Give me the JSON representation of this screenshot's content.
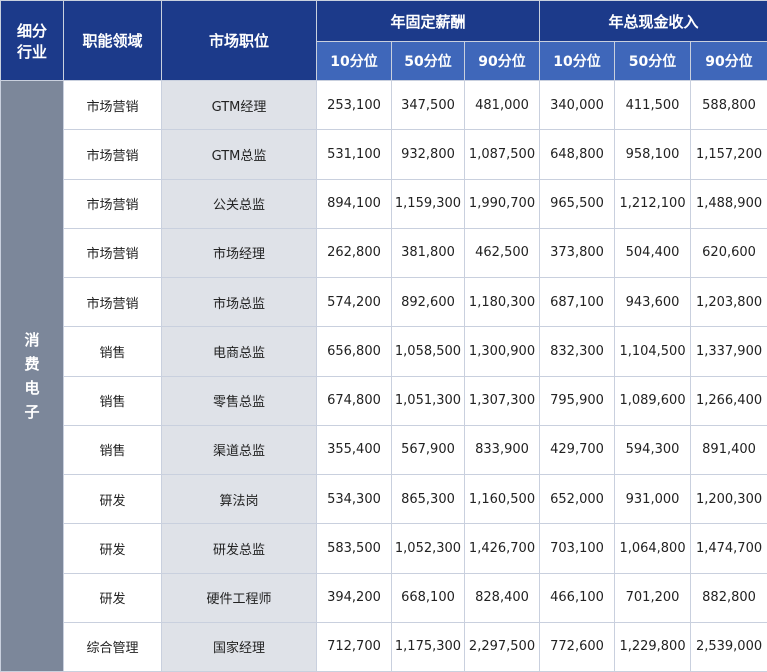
{
  "headers": {
    "industry": [
      "细分",
      "行业"
    ],
    "function": "职能领域",
    "position": "市场职位",
    "fixed_salary": "年固定薪酬",
    "total_cash": "年总现金收入",
    "percentiles": [
      "10分位",
      "50分位",
      "90分位"
    ]
  },
  "industry": [
    "消",
    "费",
    "电",
    "子"
  ],
  "rows": [
    {
      "function": "市场营销",
      "position": "GTM经理",
      "fixed": [
        "253,100",
        "347,500",
        "481,000"
      ],
      "total": [
        "340,000",
        "411,500",
        "588,800"
      ]
    },
    {
      "function": "市场营销",
      "position": "GTM总监",
      "fixed": [
        "531,100",
        "932,800",
        "1,087,500"
      ],
      "total": [
        "648,800",
        "958,100",
        "1,157,200"
      ]
    },
    {
      "function": "市场营销",
      "position": "公关总监",
      "fixed": [
        "894,100",
        "1,159,300",
        "1,990,700"
      ],
      "total": [
        "965,500",
        "1,212,100",
        "1,488,900"
      ]
    },
    {
      "function": "市场营销",
      "position": "市场经理",
      "fixed": [
        "262,800",
        "381,800",
        "462,500"
      ],
      "total": [
        "373,800",
        "504,400",
        "620,600"
      ]
    },
    {
      "function": "市场营销",
      "position": "市场总监",
      "fixed": [
        "574,200",
        "892,600",
        "1,180,300"
      ],
      "total": [
        "687,100",
        "943,600",
        "1,203,800"
      ]
    },
    {
      "function": "销售",
      "position": "电商总监",
      "fixed": [
        "656,800",
        "1,058,500",
        "1,300,900"
      ],
      "total": [
        "832,300",
        "1,104,500",
        "1,337,900"
      ]
    },
    {
      "function": "销售",
      "position": "零售总监",
      "fixed": [
        "674,800",
        "1,051,300",
        "1,307,300"
      ],
      "total": [
        "795,900",
        "1,089,600",
        "1,266,400"
      ]
    },
    {
      "function": "销售",
      "position": "渠道总监",
      "fixed": [
        "355,400",
        "567,900",
        "833,900"
      ],
      "total": [
        "429,700",
        "594,300",
        "891,400"
      ]
    },
    {
      "function": "研发",
      "position": "算法岗",
      "fixed": [
        "534,300",
        "865,300",
        "1,160,500"
      ],
      "total": [
        "652,000",
        "931,000",
        "1,200,300"
      ]
    },
    {
      "function": "研发",
      "position": "研发总监",
      "fixed": [
        "583,500",
        "1,052,300",
        "1,426,700"
      ],
      "total": [
        "703,100",
        "1,064,800",
        "1,474,700"
      ]
    },
    {
      "function": "研发",
      "position": "硬件工程师",
      "fixed": [
        "394,200",
        "668,100",
        "828,400"
      ],
      "total": [
        "466,100",
        "701,200",
        "882,800"
      ]
    },
    {
      "function": "综合管理",
      "position": "国家经理",
      "fixed": [
        "712,700",
        "1,175,300",
        "2,297,500"
      ],
      "total": [
        "772,600",
        "1,229,800",
        "2,539,000"
      ]
    }
  ],
  "colors": {
    "header_dark": "#1c3a8a",
    "header_light": "#3f67ba",
    "industry_cell": "#7c879a",
    "position_cell": "#dfe2e8",
    "grid": "#c9d0de"
  }
}
